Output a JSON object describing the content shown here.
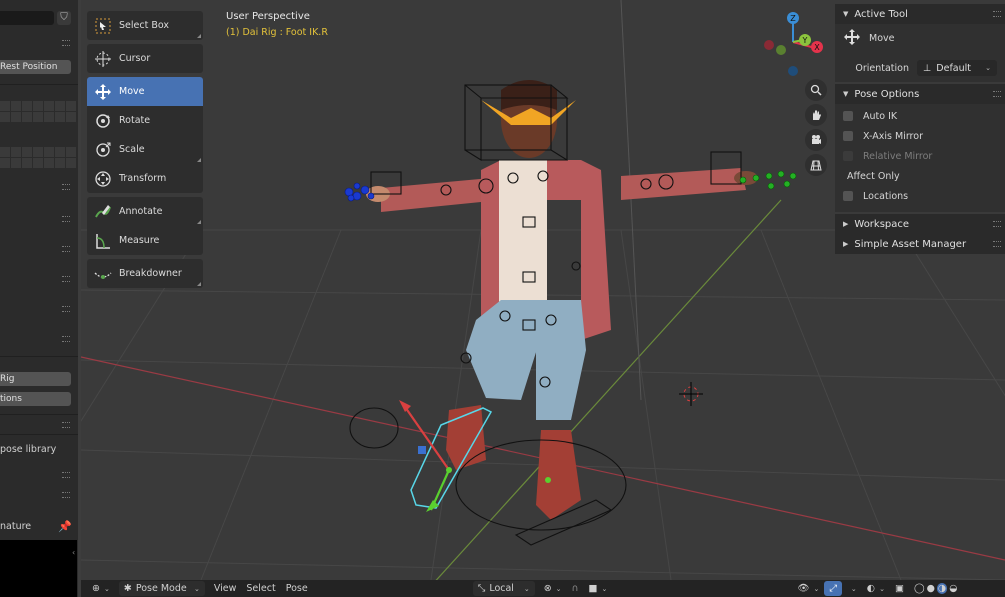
{
  "left_panel": {
    "field_top": "",
    "rest_position_label": "Rest Position",
    "rig_label": "Rig",
    "tions_label": "tions",
    "pose_library_label": "pose library",
    "nature_label": "nature"
  },
  "toolbar": {
    "tools": [
      {
        "label": "Select Box",
        "icon": "select-box-icon"
      },
      {
        "label": "Cursor",
        "icon": "cursor-icon"
      },
      {
        "label": "Move",
        "icon": "move-icon",
        "active": true
      },
      {
        "label": "Rotate",
        "icon": "rotate-icon"
      },
      {
        "label": "Scale",
        "icon": "scale-icon"
      },
      {
        "label": "Transform",
        "icon": "transform-icon"
      },
      {
        "label": "Annotate",
        "icon": "annotate-icon"
      },
      {
        "label": "Measure",
        "icon": "measure-icon"
      },
      {
        "label": "Breakdowner",
        "icon": "breakdowner-icon"
      }
    ]
  },
  "viewport": {
    "title": "User Perspective",
    "object_info": "(1) Dai Rig : Foot IK.R",
    "gizmo": {
      "x": "X",
      "y": "Y",
      "z": "Z"
    }
  },
  "sidebar": {
    "active_tool": {
      "header": "Active Tool",
      "tool_name": "Move",
      "orientation_label": "Orientation",
      "orientation_value": "Default"
    },
    "pose_options": {
      "header": "Pose Options",
      "auto_ik": "Auto IK",
      "x_axis_mirror": "X-Axis Mirror",
      "relative_mirror": "Relative Mirror",
      "affect_only": "Affect Only",
      "locations": "Locations"
    },
    "workspace_header": "Workspace",
    "asset_manager_header": "Simple Asset Manager"
  },
  "header_bar": {
    "mode": "Pose Mode",
    "menus": [
      "View",
      "Select",
      "Pose"
    ],
    "pivot": "Local"
  },
  "colors": {
    "accent": "#4772b3",
    "viewport_bg": "#3a3a3a",
    "info_text": "#e3c23a",
    "x_axis": "#e4334b",
    "y_axis": "#8cc43d",
    "z_axis": "#3a8ed6"
  }
}
